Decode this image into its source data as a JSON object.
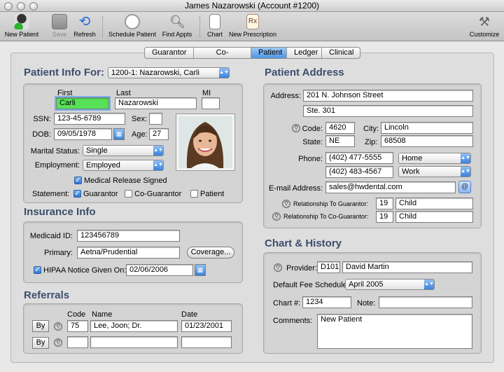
{
  "window": {
    "title": "James Nazarowski (Account #1200)"
  },
  "toolbar": {
    "new_patient": "New Patient",
    "save": "Save",
    "refresh": "Refresh",
    "schedule": "Schedule Patient",
    "find": "Find Appts",
    "chart": "Chart",
    "prescription": "New Prescription",
    "customize": "Customize"
  },
  "tabs": [
    "Guarantor",
    "Co-Guarantor",
    "Patient",
    "Ledger",
    "Clinical"
  ],
  "patient": {
    "heading": "Patient Info For:",
    "selector": "1200-1: Nazarowski, Carli",
    "first_label": "First",
    "last_label": "Last",
    "mi_label": "MI",
    "first": "Carli",
    "last": "Nazarowski",
    "mi": "",
    "ssn_label": "SSN:",
    "ssn": "123-45-6789",
    "sex_label": "Sex:",
    "sex": "",
    "dob_label": "DOB:",
    "dob": "09/05/1978",
    "age_label": "Age:",
    "age": "27",
    "marital_label": "Marital Status:",
    "marital": "Single",
    "employment_label": "Employment:",
    "employment": "Employed",
    "release_label": "Medical Release Signed",
    "statement_label": "Statement:",
    "stmt_guarantor": "Guarantor",
    "stmt_coguarantor": "Co-Guarantor",
    "stmt_patient": "Patient"
  },
  "insurance": {
    "heading": "Insurance Info",
    "medicaid_label": "Medicaid ID:",
    "medicaid": "123456789",
    "primary_label": "Primary:",
    "primary": "Aetna/Prudential",
    "coverage_button": "Coverage...",
    "hipaa_label": "HIPAA Notice Given On:",
    "hipaa_date": "02/06/2006"
  },
  "referrals": {
    "heading": "Referrals",
    "code_label": "Code",
    "name_label": "Name",
    "date_label": "Date",
    "by_label": "By",
    "rows": [
      {
        "code": "75",
        "name": "Lee, Joon; Dr.",
        "date": "01/23/2001"
      },
      {
        "code": "",
        "name": "",
        "date": ""
      }
    ]
  },
  "address": {
    "heading": "Patient Address",
    "address_label": "Address:",
    "line1": "201 N. Johnson Street",
    "line2": "Ste. 301",
    "code_label": "Code:",
    "code": "4620",
    "city_label": "City:",
    "city": "Lincoln",
    "state_label": "State:",
    "state": "NE",
    "zip_label": "Zip:",
    "zip": "68508",
    "phone_label": "Phone:",
    "phone1": "(402) 477-5555",
    "phone1_type": "Home",
    "phone2": "(402) 483-4567",
    "phone2_type": "Work",
    "email_label": "E-mail Address:",
    "email": "sales@hwdental.com",
    "rel_g_label": "Relationship To Guarantor:",
    "rel_g_code": "19",
    "rel_g": "Child",
    "rel_cg_label": "Relationship To Co-Guarantor:",
    "rel_cg_code": "19",
    "rel_cg": "Child"
  },
  "chart": {
    "heading": "Chart & History",
    "provider_label": "Provider:",
    "provider_code": "D101",
    "provider": "David Martin",
    "fee_label": "Default Fee Schedule:",
    "fee": "April 2005",
    "chart_label": "Chart #:",
    "chart_no": "1234",
    "note_label": "Note:",
    "note": "",
    "comments_label": "Comments:",
    "comments": "New Patient"
  },
  "colors": {
    "heading": "#3c4e6c",
    "accent": "#4f95e4",
    "highlight": "#56e156"
  }
}
